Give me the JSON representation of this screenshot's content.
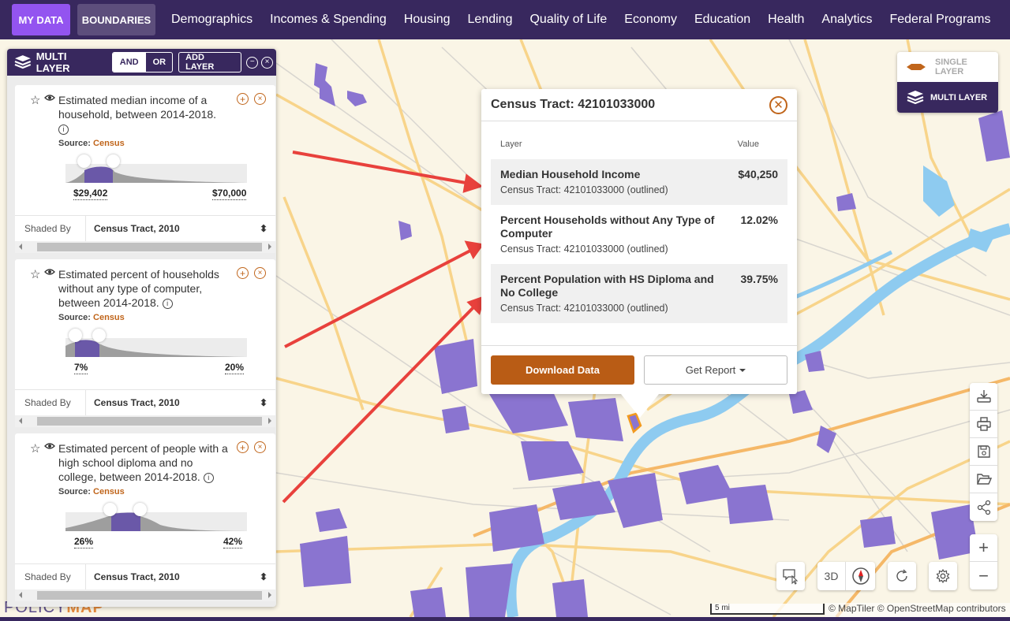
{
  "topnav": {
    "my_data": "MY DATA",
    "boundaries": "BOUNDARIES",
    "links": [
      "Demographics",
      "Incomes & Spending",
      "Housing",
      "Lending",
      "Quality of Life",
      "Economy",
      "Education",
      "Health",
      "Analytics",
      "Federal Programs"
    ]
  },
  "panel": {
    "title": "MULTI LAYER",
    "and_label": "AND",
    "or_label": "OR",
    "add_layer": "ADD LAYER",
    "layers": [
      {
        "description": "Estimated median income of a household, between 2014-2018.",
        "source_label": "Source:",
        "source": "Census",
        "min_value": "$29,402",
        "max_value": "$70,000",
        "shaded_by_label": "Shaded By",
        "shaded_by": "Census Tract, 2010"
      },
      {
        "description": "Estimated percent of households without any type of computer, between 2014-2018.",
        "source_label": "Source:",
        "source": "Census",
        "min_value": "7%",
        "max_value": "20%",
        "shaded_by_label": "Shaded By",
        "shaded_by": "Census Tract, 2010"
      },
      {
        "description": "Estimated percent of people with a high school diploma and no college, between 2014-2018.",
        "source_label": "Source:",
        "source": "Census",
        "min_value": "26%",
        "max_value": "42%",
        "shaded_by_label": "Shaded By",
        "shaded_by": "Census Tract, 2010"
      }
    ]
  },
  "logo": {
    "part1": "POLICY",
    "part2": "MAP"
  },
  "popup": {
    "title": "Census Tract: 42101033000",
    "col_layer": "Layer",
    "col_value": "Value",
    "rows": [
      {
        "name": "Median Household Income",
        "sub": "Census Tract: 42101033000 (outlined)",
        "value": "$40,250"
      },
      {
        "name": "Percent Households without Any Type of Computer",
        "sub": "Census Tract: 42101033000 (outlined)",
        "value": "12.02%"
      },
      {
        "name": "Percent Population with HS Diploma and No College",
        "sub": "Census Tract: 42101033000 (outlined)",
        "value": "39.75%"
      }
    ],
    "download": "Download Data",
    "report": "Get Report"
  },
  "mode": {
    "single": "SINGLE LAYER",
    "multi": "MULTI LAYER"
  },
  "map_controls": {
    "three_d": "3D"
  },
  "scale": "5 mi",
  "attribution": "© MapTiler © OpenStreetMap contributors",
  "colors": {
    "brand": "#38285e",
    "accent": "#c0651b",
    "my_data": "#9354f0",
    "choropleth": "#8a74d0",
    "arrow": "#e8413c"
  }
}
